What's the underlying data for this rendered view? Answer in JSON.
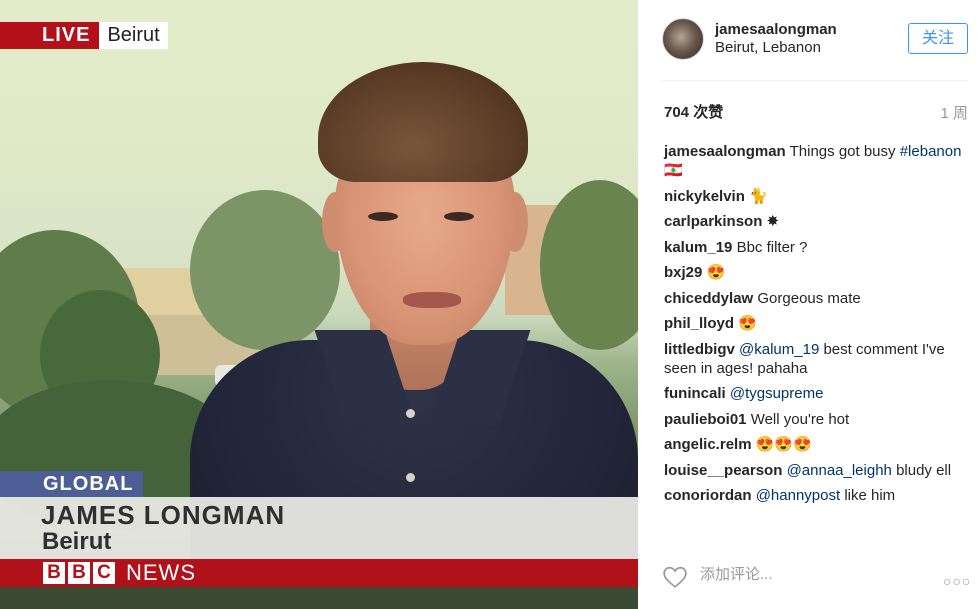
{
  "photo": {
    "live_label": "LIVE",
    "live_location": "Beirut",
    "global_label": "GLOBAL",
    "reporter_name": "JAMES LONGMAN",
    "reporter_location": "Beirut",
    "bbc_letters": [
      "B",
      "B",
      "C"
    ],
    "news_label": "NEWS"
  },
  "post": {
    "username": "jamesaalongman",
    "location": "Beirut, Lebanon",
    "follow_label": "关注",
    "likes": "704 次赞",
    "age": "1 周",
    "comment_placeholder": "添加评论...",
    "more_label": "○○○"
  },
  "comments": [
    {
      "user": "jamesaalongman",
      "text": "Things got busy",
      "tag": "#lebanon",
      "suffix": "🇱🇧"
    },
    {
      "user": "nickykelvin",
      "text": "🐈"
    },
    {
      "user": "carlparkinson",
      "text": "✸"
    },
    {
      "user": "kalum_19",
      "text": "Bbc filter ?"
    },
    {
      "user": "bxj29",
      "text": "😍"
    },
    {
      "user": "chiceddylaw",
      "text": "Gorgeous mate"
    },
    {
      "user": "phil_lloyd",
      "text": "😍"
    },
    {
      "user": "littledbigv",
      "mention": "@kalum_19",
      "text": "best comment I've seen in ages! pahaha"
    },
    {
      "user": "funincali",
      "mention": "@tygsupreme",
      "text": ""
    },
    {
      "user": "paulieboi01",
      "text": "Well you're hot"
    },
    {
      "user": "angelic.relm",
      "text": "😍😍😍"
    },
    {
      "user": "louise__pearson",
      "mention": "@annaa_leighh",
      "text": "bludy ell"
    },
    {
      "user": "conoriordan",
      "mention": "@hannypost",
      "text": "like him"
    }
  ]
}
